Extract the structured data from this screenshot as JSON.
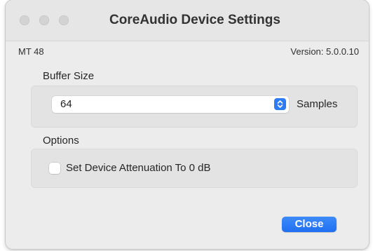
{
  "window": {
    "title": "CoreAudio Device Settings"
  },
  "info": {
    "device_name": "MT 48",
    "version": "Version: 5.0.0.10"
  },
  "buffer": {
    "section_label": "Buffer Size",
    "selected_value": "64",
    "unit_label": "Samples"
  },
  "options": {
    "section_label": "Options",
    "attenuation_label": "Set Device Attenuation To 0 dB",
    "attenuation_checked": false
  },
  "footer": {
    "close_label": "Close"
  },
  "icons": {
    "traffic_lights": [
      "close-window-icon",
      "minimize-window-icon",
      "zoom-window-icon"
    ],
    "select_arrows": "up-down-chevron-icon"
  },
  "colors": {
    "accent": "#2c7cf6",
    "window_bg": "#ececec",
    "group_bg": "#e3e3e3",
    "traffic_inactive": "#d3d3d3"
  }
}
